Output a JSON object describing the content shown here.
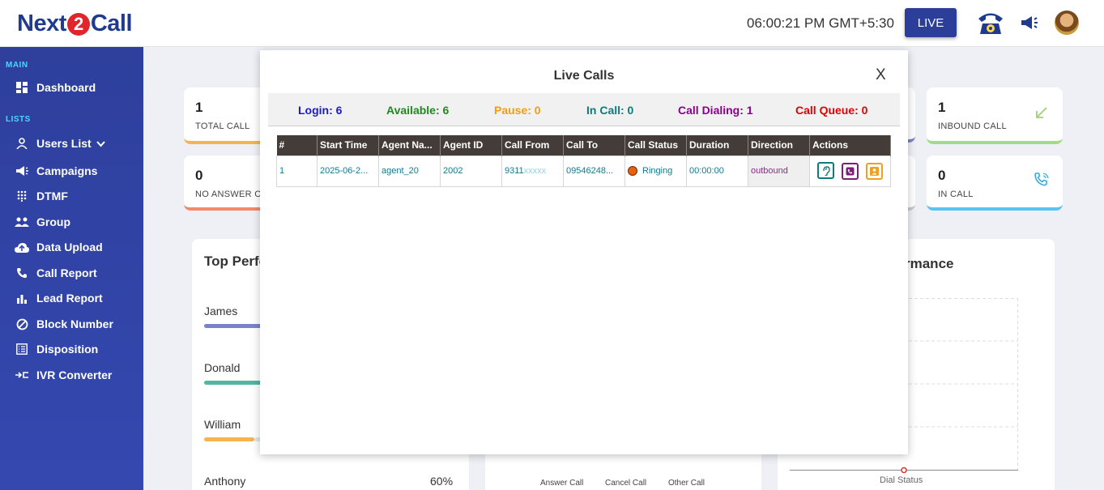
{
  "brand": {
    "prefix": "Next",
    "mid": "2",
    "suffix": "Call"
  },
  "header": {
    "time": "06:00:21 PM GMT+5:30",
    "live_label": "LIVE"
  },
  "sidebar": {
    "section_main": "MAIN",
    "section_lists": "LISTS",
    "items": [
      {
        "label": "Dashboard",
        "icon": "dashboard-icon"
      },
      {
        "label": "Users List",
        "icon": "user-icon"
      },
      {
        "label": "Campaigns",
        "icon": "megaphone-icon"
      },
      {
        "label": "DTMF",
        "icon": "dialpad-icon"
      },
      {
        "label": "Group",
        "icon": "group-icon"
      },
      {
        "label": "Data Upload",
        "icon": "cloud-upload-icon"
      },
      {
        "label": "Call Report",
        "icon": "phone-icon"
      },
      {
        "label": "Lead Report",
        "icon": "bar-chart-icon"
      },
      {
        "label": "Block Number",
        "icon": "block-icon"
      },
      {
        "label": "Disposition",
        "icon": "list-icon"
      },
      {
        "label": "IVR Converter",
        "icon": "converter-icon"
      }
    ]
  },
  "stats": {
    "total_call": {
      "value": "1",
      "label": "TOTAL CALL"
    },
    "no_answer": {
      "value": "0",
      "label": "NO ANSWER CA"
    },
    "inbound": {
      "value": "1",
      "label": "INBOUND CALL"
    },
    "in_call": {
      "value": "0",
      "label": "IN CALL"
    }
  },
  "panels": {
    "top_performer_title": "Top Perfo",
    "right_title": "rmance",
    "performers": [
      {
        "name": "James"
      },
      {
        "name": "Donald"
      },
      {
        "name": "William"
      },
      {
        "name": "Anthony",
        "percent": "60%"
      }
    ],
    "legend": [
      "Answer Call",
      "Cancel Call",
      "Other Call"
    ],
    "dial_status": "Dial Status"
  },
  "modal": {
    "title": "Live Calls",
    "close": "X",
    "summary": {
      "login": "Login: 6",
      "available": "Available: 6",
      "pause": "Pause: 0",
      "in_call": "In Call: 0",
      "dialing": "Call Dialing: 1",
      "queue": "Call Queue: 0"
    },
    "columns": [
      "#",
      "Start Time",
      "Agent Na...",
      "Agent ID",
      "Call From",
      "Call To",
      "Call Status",
      "Duration",
      "Direction",
      "Actions"
    ],
    "rows": [
      {
        "num": "1",
        "start": "2025-06-2...",
        "agent": "agent_20",
        "agent_id": "2002",
        "from_visible": "9311",
        "from_masked": "xxxxx",
        "to": "09546248...",
        "status": "Ringing",
        "duration": "00:00:00",
        "direction": "outbound"
      }
    ]
  },
  "colors": {
    "login": "#1a1ad0",
    "available": "#1e8a1e",
    "pause": "#f39c12",
    "in_call": "#0e7a7a",
    "dialing": "#8b008b",
    "queue": "#e00000"
  }
}
